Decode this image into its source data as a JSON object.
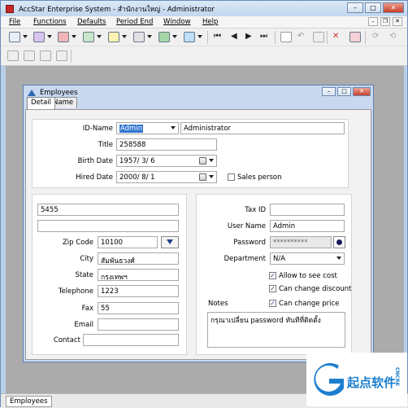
{
  "app": {
    "title": "AccStar Enterprise System - สำนักงานใหญ่ - Administrator",
    "menu": [
      "File",
      "Functions",
      "Defaults",
      "Period End",
      "Window",
      "Help"
    ]
  },
  "child_window": {
    "title": "Employees",
    "tabs": [
      "Detail",
      "Name"
    ]
  },
  "form": {
    "id_name_label": "ID-Name",
    "id_value": "Admin",
    "name_value": "Administrator",
    "title_label": "Title",
    "title_value": "258588",
    "birth_date_label": "Birth Date",
    "birth_date_value": "1957/ 3/ 6",
    "hired_date_label": "Hired Date",
    "hired_date_value": "2000/ 8/ 1",
    "sales_person_label": "Sales person",
    "sales_person_checked": false,
    "address_line1": "5455",
    "address_line2": "",
    "zip_code_label": "Zip Code",
    "zip_code_value": "10100",
    "city_label": "City",
    "city_value": "สัมพันธวงศ์",
    "state_label": "State",
    "state_value": "กรุงเทพฯ",
    "telephone_label": "Telephone",
    "telephone_value": "1223",
    "fax_label": "Fax",
    "fax_value": "55",
    "email_label": "Email",
    "email_value": "",
    "contact_label": "Contact",
    "contact_value": "",
    "tax_id_label": "Tax ID",
    "tax_id_value": "",
    "user_name_label": "User Name",
    "user_name_value": "Admin",
    "password_label": "Password",
    "password_value": "**********",
    "department_label": "Department",
    "department_value": "N/A",
    "allow_see_cost_label": "Allow to see cost",
    "allow_see_cost_checked": true,
    "can_change_discount_label": "Can change discount",
    "can_change_discount_checked": true,
    "can_change_price_label": "Can change price",
    "can_change_price_checked": true,
    "notes_label": "Notes",
    "notes_value": "กรุณาเปลี่ยน password ทันทีที่ติดตั้ง"
  },
  "statusbar": {
    "active_window": "Employees"
  },
  "watermark": {
    "text": "起点软件",
    "domain": "CNCRK"
  },
  "colors": {
    "window_frame": "#b9cfe8",
    "client_bg": "#ababab",
    "selection": "#3176d0",
    "checkmark": "#1b3f8a"
  }
}
